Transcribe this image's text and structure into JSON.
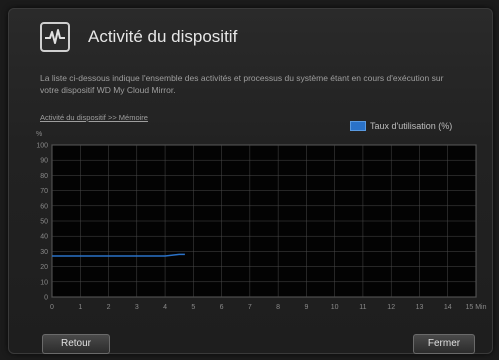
{
  "dialog": {
    "title": "Activité du dispositif",
    "description": "La liste ci-dessous indique l'ensemble des activités et processus du système étant en cours d'exécution sur votre dispositif WD My Cloud Mirror.",
    "breadcrumb": "Activité du dispositif >> Mémoire",
    "icon": "activity-pulse-icon",
    "accent_color": "#2a72c8"
  },
  "chart_data": {
    "type": "line",
    "ylabel": "%",
    "xlabel_suffix": "Min",
    "xlim": [
      0,
      15
    ],
    "ylim": [
      0,
      100
    ],
    "yticks": [
      0,
      10,
      20,
      30,
      40,
      50,
      60,
      70,
      80,
      90,
      100
    ],
    "xticks": [
      0,
      1,
      2,
      3,
      4,
      5,
      6,
      7,
      8,
      9,
      10,
      11,
      12,
      13,
      14,
      15
    ],
    "grid": true,
    "legend_placement": "top-right",
    "series": [
      {
        "name": "Taux d'utilisation (%)",
        "color": "#2a72c8",
        "x": [
          0,
          0.5,
          1,
          1.5,
          2,
          2.5,
          3,
          3.5,
          4,
          4.5,
          4.7
        ],
        "y": [
          27,
          27,
          27,
          27,
          27,
          27,
          27,
          27,
          27,
          28,
          28
        ]
      }
    ]
  },
  "buttons": {
    "back_label": "Retour",
    "close_label": "Fermer"
  }
}
